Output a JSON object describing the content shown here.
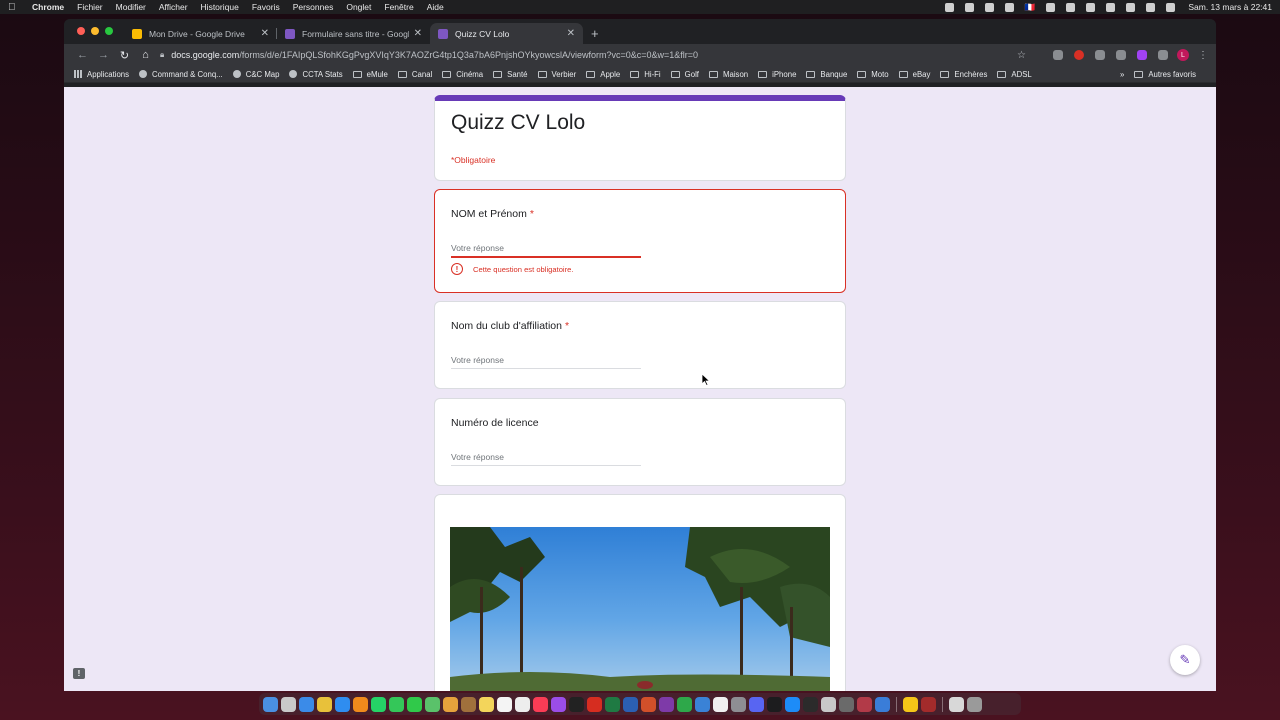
{
  "menubar": {
    "apple_icon": "apple-icon",
    "items": [
      "Chrome",
      "Fichier",
      "Modifier",
      "Afficher",
      "Historique",
      "Favoris",
      "Personnes",
      "Onglet",
      "Fenêtre",
      "Aide"
    ],
    "flag": "🇫🇷",
    "clock": "Sam. 13 mars à 22:41"
  },
  "browser": {
    "tabs": [
      {
        "label": "Mon Drive - Google Drive",
        "icon": "google-drive-icon",
        "favicon_color": "#fbbc04",
        "active": false
      },
      {
        "label": "Formulaire sans titre - Google",
        "icon": "google-forms-icon",
        "favicon_color": "#7e57c2",
        "active": false
      },
      {
        "label": "Quizz CV Lolo",
        "icon": "google-forms-icon",
        "favicon_color": "#7e57c2",
        "active": true
      }
    ],
    "url_host": "docs.google.com",
    "url_path": "/forms/d/e/1FAIpQLSfohKGgPvgXVIqY3K7AOZrG4tp1Q3a7bA6PnjshOYkyowcslA/viewform?vc=0&c=0&w=1&flr=0",
    "profile_initial": "L",
    "bookmarks": [
      {
        "label": "Applications",
        "icon": "apps-grid-icon"
      },
      {
        "label": "Command & Conq...",
        "icon": "site-icon"
      },
      {
        "label": "C&C Map",
        "icon": "site-icon"
      },
      {
        "label": "CCTA Stats",
        "icon": "site-icon"
      },
      {
        "label": "eMule",
        "icon": "folder-icon"
      },
      {
        "label": "Canal",
        "icon": "folder-icon"
      },
      {
        "label": "Cinéma",
        "icon": "folder-icon"
      },
      {
        "label": "Santé",
        "icon": "folder-icon"
      },
      {
        "label": "Verbier",
        "icon": "folder-icon"
      },
      {
        "label": "Apple",
        "icon": "folder-icon"
      },
      {
        "label": "Hi-Fi",
        "icon": "folder-icon"
      },
      {
        "label": "Golf",
        "icon": "folder-icon"
      },
      {
        "label": "Maison",
        "icon": "folder-icon"
      },
      {
        "label": "iPhone",
        "icon": "folder-icon"
      },
      {
        "label": "Banque",
        "icon": "folder-icon"
      },
      {
        "label": "Moto",
        "icon": "folder-icon"
      },
      {
        "label": "eBay",
        "icon": "folder-icon"
      },
      {
        "label": "Enchères",
        "icon": "folder-icon"
      },
      {
        "label": "ADSL",
        "icon": "folder-icon"
      }
    ],
    "bookmarks_more": "»",
    "other_bookmarks": "Autres favoris"
  },
  "form": {
    "title": "Quizz CV Lolo",
    "required_note": "*Obligatoire",
    "accent_color": "#673ab7",
    "error_color": "#d93025",
    "questions": [
      {
        "title": "NOM et Prénom",
        "required_mark": "*",
        "placeholder": "Votre réponse",
        "error": "Cette question est obligatoire."
      },
      {
        "title": "Nom du club d'affiliation",
        "required_mark": "*",
        "placeholder": "Votre réponse"
      },
      {
        "title": "Numéro de licence",
        "required_mark": "",
        "placeholder": "Votre réponse"
      }
    ]
  }
}
